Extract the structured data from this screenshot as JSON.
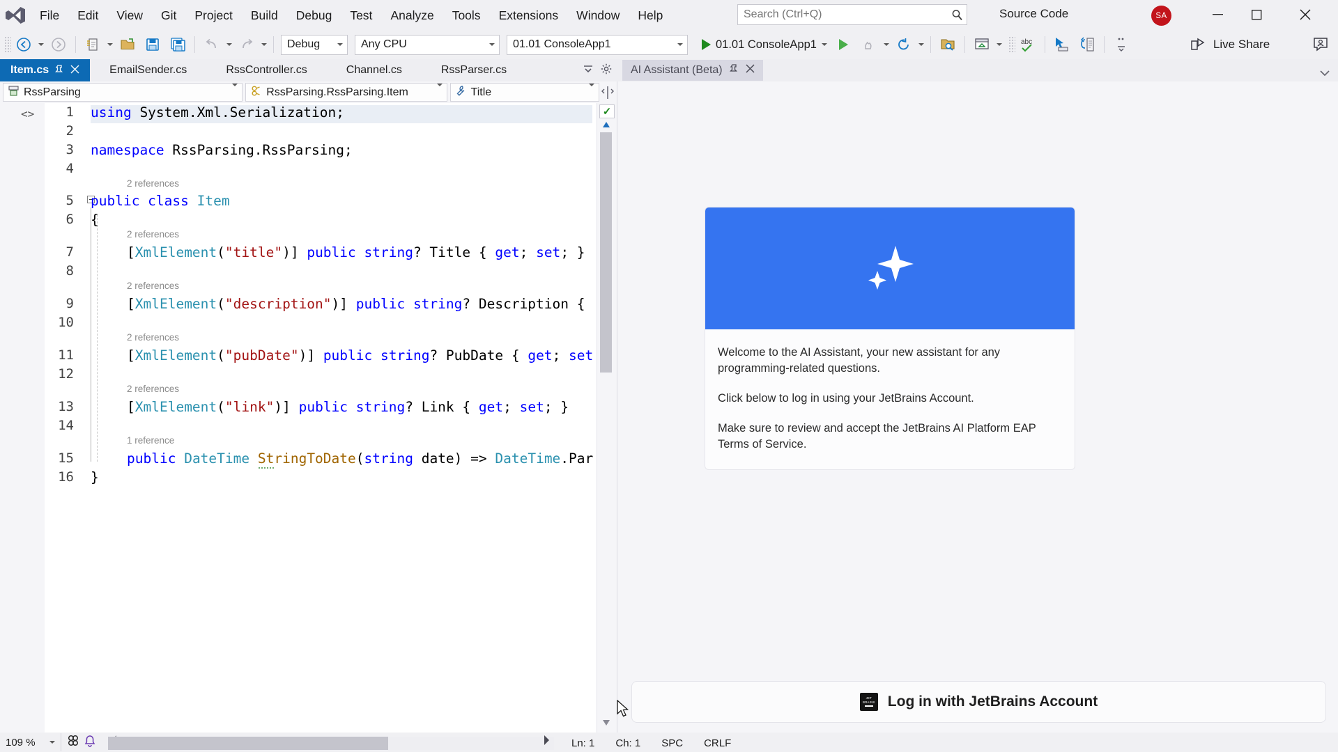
{
  "app": {
    "title_right": "Source Code",
    "avatar_initials": "SA",
    "logo_icon": "visual-studio-logo"
  },
  "menu": {
    "items": [
      {
        "label": "File"
      },
      {
        "label": "Edit"
      },
      {
        "label": "View"
      },
      {
        "label": "Git"
      },
      {
        "label": "Project"
      },
      {
        "label": "Build"
      },
      {
        "label": "Debug"
      },
      {
        "label": "Test"
      },
      {
        "label": "Analyze"
      },
      {
        "label": "Tools"
      },
      {
        "label": "Extensions"
      },
      {
        "label": "Window"
      },
      {
        "label": "Help"
      }
    ]
  },
  "search": {
    "placeholder": "Search (Ctrl+Q)",
    "value": "",
    "icon": "search-icon"
  },
  "window_controls": {
    "minimize": "─",
    "maximize": "☐",
    "close": "✕"
  },
  "toolbar": {
    "back_icon": "navigate-back-icon",
    "forward_icon": "navigate-forward-icon",
    "new_item_icon": "new-item-icon",
    "open_file_icon": "open-file-icon",
    "save_icon": "save-icon",
    "save_all_icon": "save-all-icon",
    "undo_icon": "undo-icon",
    "redo_icon": "redo-icon",
    "configuration": "Debug",
    "platform": "Any CPU",
    "startup_project": "01.01 ConsoleApp1",
    "run_label": "01.01 ConsoleApp1",
    "run_icon": "start-debugging-icon",
    "run_no_debug_icon": "start-without-debugging-icon",
    "hot_reload_icon": "hot-reload-icon",
    "restart_icon": "restart-icon",
    "solution_explorer_icon": "solution-explorer-search-icon",
    "live_preview_icon": "live-preview-icon",
    "spell_check_icon": "spell-check-icon",
    "pointer_select_icon": "pointer-select-icon",
    "compare_icon": "compare-files-icon",
    "overflow_icon": "toolbar-overflow-icon",
    "live_share_label": "Live Share",
    "live_share_icon": "live-share-icon",
    "feedback_icon": "send-feedback-icon"
  },
  "tabs": {
    "active": "Item.cs",
    "items": [
      {
        "label": "Item.cs",
        "active": true,
        "pin_icon": "pin-icon",
        "close_icon": "close-icon"
      },
      {
        "label": "EmailSender.cs",
        "active": false
      },
      {
        "label": "RssController.cs",
        "active": false
      },
      {
        "label": "Channel.cs",
        "active": false
      },
      {
        "label": "RssParser.cs",
        "active": false
      }
    ],
    "overflow_icon": "tab-overflow-icon",
    "settings_icon": "gear-icon"
  },
  "ai_tab": {
    "label": "AI Assistant (Beta)",
    "pin_icon": "pin-icon",
    "close_icon": "close-icon",
    "chevron_icon": "chevron-down-icon"
  },
  "navbar": {
    "project": "RssParsing",
    "project_icon": "project-icon",
    "type": "RssParsing.RssParsing.Item",
    "type_icon": "class-icon",
    "member": "Title",
    "member_icon": "property-icon",
    "split_icon": "split-view-icon"
  },
  "editor": {
    "indicator_icon": "code-indicator-icon",
    "file": "Item.cs",
    "lines": [
      {
        "n": 1,
        "text": "using System.Xml.Serialization;"
      },
      {
        "n": 2,
        "text": ""
      },
      {
        "n": 3,
        "text": "namespace RssParsing.RssParsing;"
      },
      {
        "n": 4,
        "text": ""
      },
      {
        "n": 5,
        "text": "public class Item",
        "ref": "2 references"
      },
      {
        "n": 6,
        "text": "{"
      },
      {
        "n": 7,
        "text": "    [XmlElement(\"title\")] public string? Title { get; set; }",
        "ref": "2 references"
      },
      {
        "n": 8,
        "text": ""
      },
      {
        "n": 9,
        "text": "    [XmlElement(\"description\")] public string? Description {",
        "ref": "2 references"
      },
      {
        "n": 10,
        "text": ""
      },
      {
        "n": 11,
        "text": "    [XmlElement(\"pubDate\")] public string? PubDate { get; set",
        "ref": "2 references"
      },
      {
        "n": 12,
        "text": ""
      },
      {
        "n": 13,
        "text": "    [XmlElement(\"link\")] public string? Link { get; set; }",
        "ref": "2 references"
      },
      {
        "n": 14,
        "text": ""
      },
      {
        "n": 15,
        "text": "    public DateTime StringToDate(string date) => DateTime.Par",
        "ref": "1 reference"
      },
      {
        "n": 16,
        "text": "}"
      }
    ],
    "health_indicator": "✓",
    "scroll_up_icon": "scroll-up-icon",
    "scroll_down_icon": "scroll-down-icon"
  },
  "ai_panel": {
    "hero_icon": "ai-sparkle-icon",
    "hero_color": "#3574f0",
    "paragraphs": [
      "Welcome to the AI Assistant, your new assistant for any programming-related questions.",
      "Click below to log in using your JetBrains Account.",
      "Make sure to review and accept the JetBrains AI Platform EAP Terms of Service."
    ],
    "login_button": "Log in with JetBrains Account",
    "login_icon": "jetbrains-logo-icon"
  },
  "statusbar": {
    "zoom": "109 %",
    "zoom_caret_icon": "chevron-down-icon",
    "bug_icon": "debug-indicator-icon",
    "notify_icon": "notification-icon",
    "scroll_left_icon": "scroll-left-icon",
    "scroll_right_icon": "scroll-right-icon",
    "line": "Ln: 1",
    "column": "Ch: 1",
    "spaces": "SPC",
    "line_endings": "CRLF"
  },
  "colors": {
    "accent_blue": "#0d6ab4",
    "hero_blue": "#3574f0",
    "avatar_red": "#c2141b",
    "keyword": "#0000ff",
    "type": "#2b91af",
    "string": "#a31515",
    "method": "#a06500"
  }
}
